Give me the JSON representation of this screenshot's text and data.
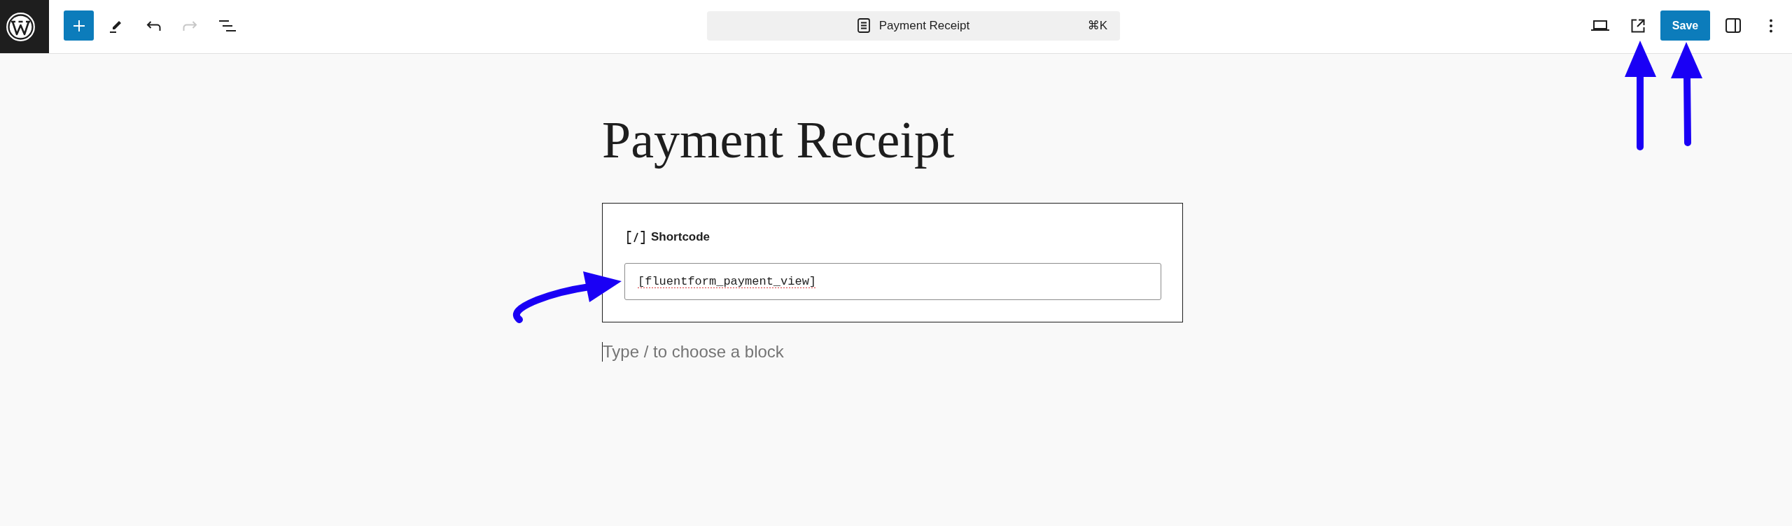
{
  "top_bar": {
    "tools": [
      {
        "kind": "add",
        "disabled": false
      },
      {
        "kind": "edit",
        "disabled": false
      },
      {
        "kind": "undo",
        "disabled": false
      },
      {
        "kind": "redo",
        "disabled": true
      },
      {
        "kind": "list",
        "disabled": false
      }
    ],
    "command_bar": {
      "title": "Payment Receipt",
      "shortcut": "⌘K"
    },
    "actions": [
      {
        "kind": "preview"
      },
      {
        "kind": "view"
      },
      {
        "kind": "save",
        "label": "Save"
      },
      {
        "kind": "sidebar"
      },
      {
        "kind": "options"
      }
    ]
  },
  "editor": {
    "title": "Payment Receipt",
    "blocks": [
      {
        "kind": "shortcode",
        "label": "Shortcode",
        "value": "[fluentform_payment_view]",
        "spellcheck_error": true
      },
      {
        "kind": "paragraph",
        "placeholder": "Type / to choose a block"
      }
    ]
  }
}
